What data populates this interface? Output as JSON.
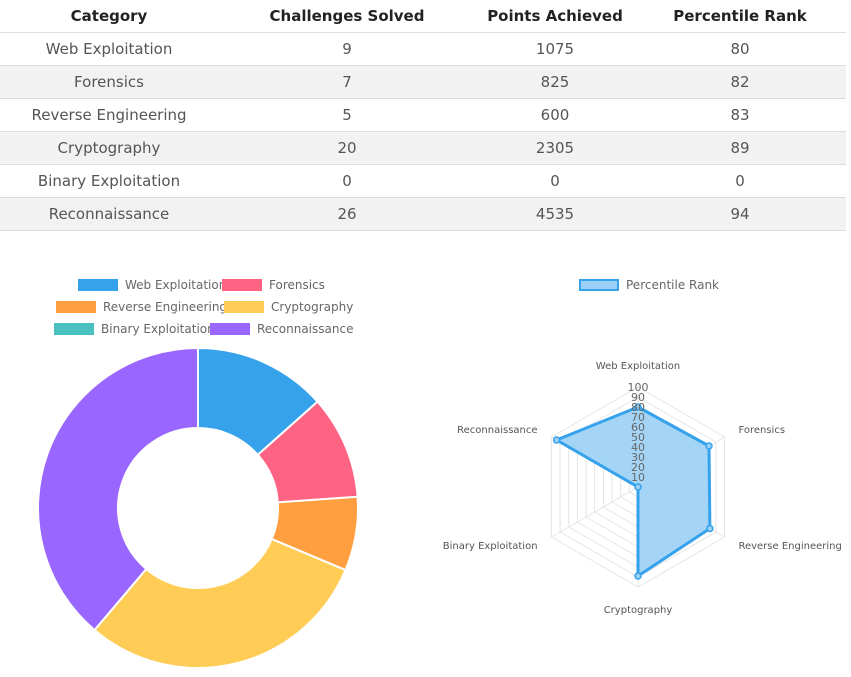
{
  "table": {
    "headers": [
      "Category",
      "Challenges Solved",
      "Points Achieved",
      "Percentile Rank"
    ],
    "rows": [
      [
        "Web Exploitation",
        "9",
        "1075",
        "80"
      ],
      [
        "Forensics",
        "7",
        "825",
        "82"
      ],
      [
        "Reverse Engineering",
        "5",
        "600",
        "83"
      ],
      [
        "Cryptography",
        "20",
        "2305",
        "89"
      ],
      [
        "Binary Exploitation",
        "0",
        "0",
        "0"
      ],
      [
        "Reconnaissance",
        "26",
        "4535",
        "94"
      ]
    ]
  },
  "chart_data": [
    {
      "type": "doughnut",
      "categories": [
        "Web Exploitation",
        "Forensics",
        "Reverse Engineering",
        "Cryptography",
        "Binary Exploitation",
        "Reconnaissance"
      ],
      "values": [
        9,
        7,
        5,
        20,
        0,
        26
      ],
      "colors": [
        "#36a2eb",
        "#ff6384",
        "#ff9f40",
        "#ffcd56",
        "#4bc0c0",
        "#9966ff"
      ],
      "legend": "top"
    },
    {
      "type": "radar",
      "categories": [
        "Web Exploitation",
        "Forensics",
        "Reverse Engineering",
        "Cryptography",
        "Binary Exploitation",
        "Reconnaissance"
      ],
      "series": [
        {
          "name": "Percentile Rank",
          "values": [
            80,
            82,
            83,
            89,
            0,
            94
          ]
        }
      ],
      "ticks": [
        "10",
        "20",
        "30",
        "40",
        "50",
        "60",
        "70",
        "80",
        "90",
        "100"
      ],
      "rlim": [
        0,
        100
      ],
      "color": "#36a2eb",
      "fill": "#9ad0f5",
      "legend": "top"
    }
  ]
}
